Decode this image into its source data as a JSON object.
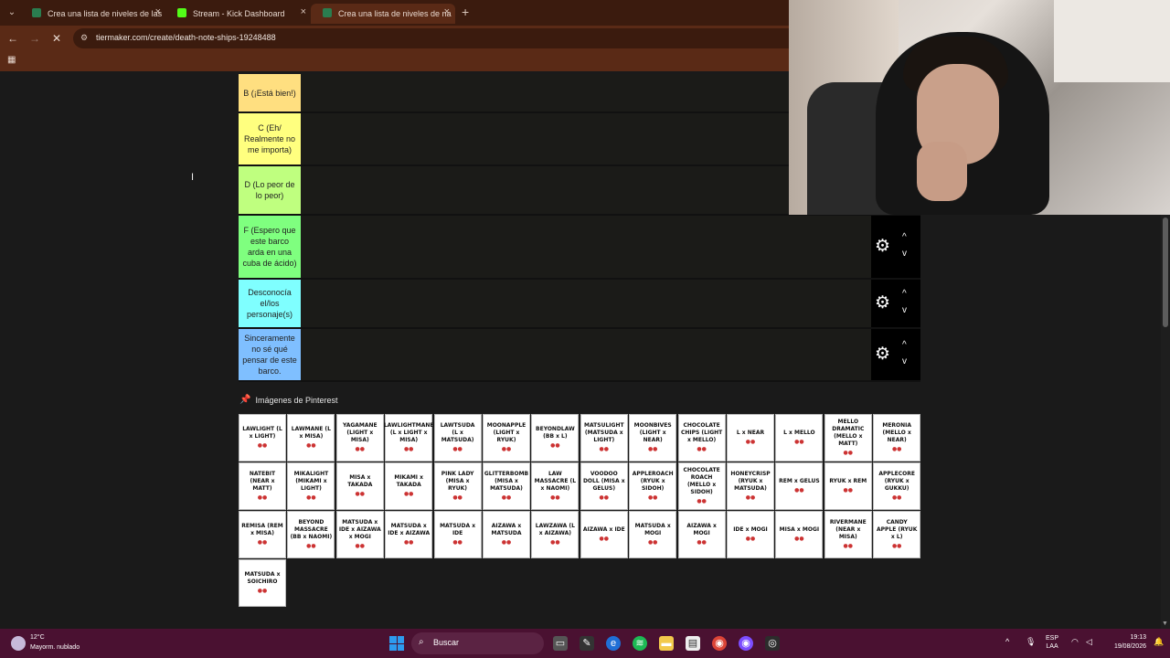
{
  "browser": {
    "tabs": [
      {
        "title": "Crea una lista de niveles de las",
        "favicon_color": "#2a7d4f"
      },
      {
        "title": "Stream - Kick Dashboard",
        "favicon_color": "#53fc18"
      },
      {
        "title": "Crea una lista de niveles de na",
        "favicon_color": "#2a7d4f"
      }
    ],
    "url": "tiermaker.com/create/death-note-ships-19248488",
    "close_glyph": "×",
    "new_tab_glyph": "+"
  },
  "tiers": [
    {
      "label": "B (¡Está bien!)",
      "color": "#ffdf80"
    },
    {
      "label": "C (Eh/ Realmente no me importa)",
      "color": "#ffff7f"
    },
    {
      "label": "D (Lo peor de lo peor)",
      "color": "#bfff7f"
    },
    {
      "label": "F (Espero que este barco arda en una cuba de ácido)",
      "color": "#7fff7f"
    },
    {
      "label": "Desconocía el/los personaje(s)",
      "color": "#7fffff"
    },
    {
      "label": "Sinceramente no sé qué pensar de este barco.",
      "color": "#7fbfff"
    }
  ],
  "pinterest": {
    "header": "Imágenes de Pinterest",
    "cards": [
      "LAWLIGHT (L x LIGHT)",
      "LAWMANE (L x MISA)",
      "YAGAMANE (LIGHT x MISA)",
      "LAWLIGHTMANE (L x LIGHT x MISA)",
      "LAWTSUDA (L x MATSUDA)",
      "MOONAPPLE (LIGHT x RYUK)",
      "BEYONDLAW (BB x L)",
      "MATSULIGHT (MATSUDA x LIGHT)",
      "MOONBIVES (LIGHT x NEAR)",
      "CHOCOLATE CHIPS (LIGHT x MELLO)",
      "L x NEAR",
      "L x MELLO",
      "MELLO DRAMATIC (MELLO x MATT)",
      "MERONIA (MELLO x NEAR)",
      "NATEBIT (NEAR x MATT)",
      "MIKALIGHT (MIKAMI x LIGHT)",
      "MISA x TAKADA",
      "MIKAMI x TAKADA",
      "PINK LADY (MISA x RYUK)",
      "GLITTERBOMB (MISA x MATSUDA)",
      "LAW MASSACRE (L x NAOMI)",
      "VOODOO DOLL (MISA x GELUS)",
      "APPLEROACH (RYUK x SIDOH)",
      "CHOCOLATE ROACH (MELLO x SIDOH)",
      "HONEYCRISP (RYUK x MATSUDA)",
      "REM x GELUS",
      "RYUK x REM",
      "APPLECORE (RYUK x GUKKU)",
      "REMISA (REM x MISA)",
      "BEYOND MASSACRE (BB x NAOMI)",
      "MATSUDA x IDE x AIZAWA x MOGI",
      "MATSUDA x IDE x AIZAWA",
      "MATSUDA x IDE",
      "AIZAWA x MATSUDA",
      "LAWZAWA (L x AIZAWA)",
      "AIZAWA x IDE",
      "MATSUDA x MOGI",
      "AIZAWA x MOGI",
      "IDE x MOGI",
      "MISA x MOGI",
      "RIVERMANE (NEAR x MISA)",
      "CANDY APPLE (RYUK x L)",
      "MATSUDA x SOICHIRO"
    ],
    "card_emoji": "●●"
  },
  "tier_controls": {
    "gear": "⚙",
    "up": "^",
    "down": "v"
  },
  "taskbar": {
    "weather_temp": "12°C",
    "weather_desc": "Mayorm. nublado",
    "search_placeholder": "Buscar",
    "lang_line1": "ESP",
    "lang_line2": "LAA",
    "time": "19:13",
    "date": "19/08/2026",
    "accent": "#4a1131"
  }
}
